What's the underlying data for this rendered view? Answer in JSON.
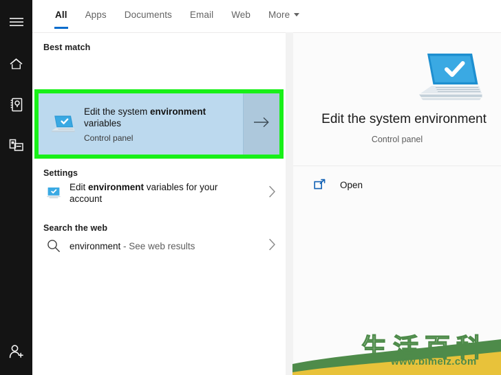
{
  "rail": {
    "items": [
      {
        "name": "hamburger-menu",
        "label": "Menu"
      },
      {
        "name": "home",
        "label": "Home"
      },
      {
        "name": "notebook",
        "label": "Notebook"
      },
      {
        "name": "collections",
        "label": "Collections"
      }
    ],
    "bottom": {
      "name": "add-account",
      "label": "Account"
    }
  },
  "tabs": [
    {
      "label": "All",
      "active": true
    },
    {
      "label": "Apps",
      "active": false
    },
    {
      "label": "Documents",
      "active": false
    },
    {
      "label": "Email",
      "active": false
    },
    {
      "label": "Web",
      "active": false
    },
    {
      "label": "More",
      "active": false,
      "caret": true
    }
  ],
  "sections": {
    "best_match": {
      "heading": "Best match",
      "item": {
        "title_prefix": "Edit the system ",
        "title_bold": "environment",
        "title_suffix": " variables",
        "subtitle": "Control panel",
        "icon": "laptop-check-icon",
        "arrow": "arrow-right-icon",
        "highlight_color": "#18f018",
        "selected_color": "#bcd9ee"
      }
    },
    "settings": {
      "heading": "Settings",
      "item": {
        "title_prefix": "Edit ",
        "title_bold": "environment",
        "title_suffix": " variables for your account",
        "icon": "monitor-check-icon",
        "chevron": "chevron-right-icon"
      }
    },
    "search_web": {
      "heading": "Search the web",
      "item": {
        "query": "environment",
        "hint": " - See web results",
        "icon": "search-icon",
        "chevron": "chevron-right-icon"
      }
    }
  },
  "preview": {
    "title": "Edit the system environment",
    "subtitle": "Control panel",
    "art_icon": "laptop-check-large-icon",
    "actions": [
      {
        "label": "Open",
        "icon": "open-external-icon"
      }
    ]
  },
  "watermark": {
    "cn_text": "生活百科",
    "url": "www.bimeiz.com",
    "color": "#4e8b4a"
  },
  "theme": {
    "accent": "#0a6ccc",
    "rail_bg": "#141414",
    "pane_bg": "#ffffff",
    "preview_bg": "#fbfbfb"
  }
}
